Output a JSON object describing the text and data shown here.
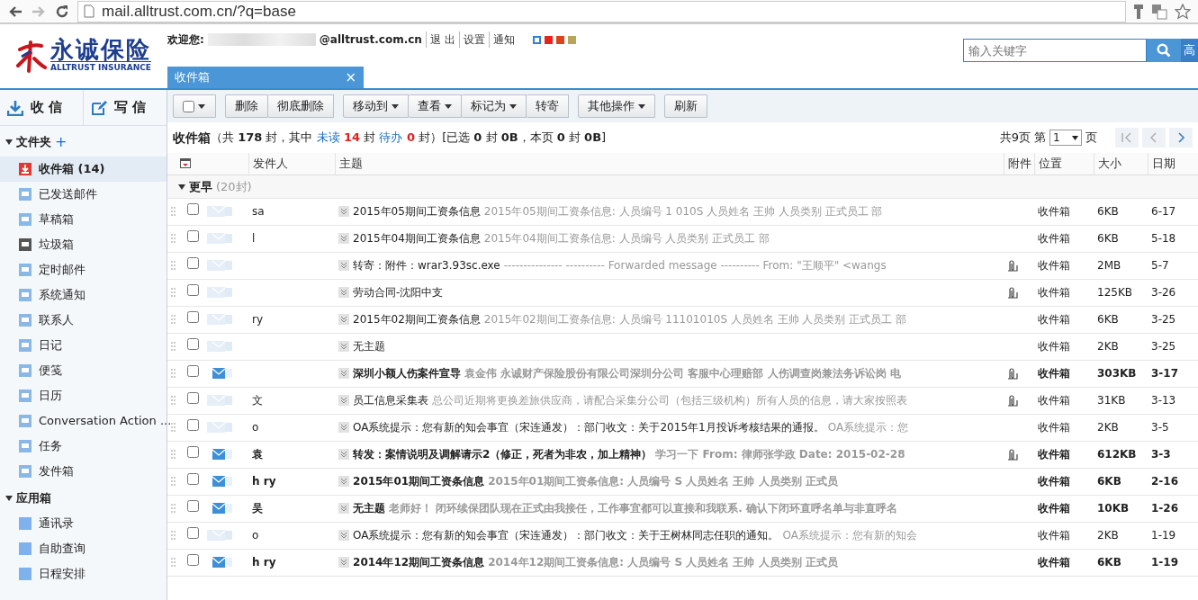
{
  "browser": {
    "url": "mail.alltrust.com.cn/?q=base"
  },
  "logo": {
    "name": "永诚保险",
    "subtitle": "ALLTRUST INSURANCE"
  },
  "user": {
    "greeting": "欢迎您:",
    "email": "@alltrust.com.cn",
    "links": [
      "退 出",
      "设置",
      "通知"
    ],
    "skins": [
      {
        "color": "#2f80d8",
        "selected": true
      },
      {
        "color": "#e8231c",
        "selected": false
      },
      {
        "color": "#d9441a",
        "selected": false
      },
      {
        "color": "#b8a55a",
        "selected": false
      }
    ]
  },
  "search": {
    "placeholder": "输入关键字",
    "advanced": "高"
  },
  "tabs": [
    {
      "label": "收件箱",
      "selected": true,
      "close": "×"
    }
  ],
  "sidebar": {
    "actions": [
      {
        "label": "收 信",
        "kind": "receive"
      },
      {
        "label": "写 信",
        "kind": "compose"
      }
    ],
    "sections": [
      {
        "title": "文件夹",
        "add": "+",
        "expanded": true,
        "items": [
          {
            "label": "收件箱",
            "count": "(14)",
            "kind": "inbox",
            "selected": true
          },
          {
            "label": "已发送邮件",
            "kind": "folder",
            "selected": false
          },
          {
            "label": "草稿箱",
            "kind": "folder",
            "selected": false
          },
          {
            "label": "垃圾箱",
            "kind": "trash",
            "selected": false
          },
          {
            "label": "定时邮件",
            "kind": "folder",
            "selected": false
          },
          {
            "label": "系统通知",
            "kind": "folder",
            "selected": false
          },
          {
            "label": "联系人",
            "kind": "folder",
            "selected": false
          },
          {
            "label": "日记",
            "kind": "folder",
            "selected": false
          },
          {
            "label": "便笺",
            "kind": "folder",
            "selected": false
          },
          {
            "label": "日历",
            "kind": "folder",
            "selected": false
          },
          {
            "label": "Conversation Action ...",
            "kind": "folder",
            "selected": false
          },
          {
            "label": "任务",
            "kind": "folder",
            "selected": false
          },
          {
            "label": "发件箱",
            "kind": "folder",
            "selected": false
          }
        ]
      },
      {
        "title": "应用箱",
        "expanded": true,
        "items": [
          {
            "label": "通讯录",
            "kind": "app",
            "selected": false
          },
          {
            "label": "自助查询",
            "kind": "app",
            "selected": false
          },
          {
            "label": "日程安排",
            "kind": "app",
            "selected": false
          }
        ]
      }
    ]
  },
  "toolbar": [
    [
      {
        "kind": "select",
        "checked": false
      }
    ],
    [
      {
        "label": "删除",
        "kind": "button"
      },
      {
        "label": "彻底删除",
        "kind": "button"
      }
    ],
    [
      {
        "label": "移动到",
        "kind": "menu"
      },
      {
        "label": "查看",
        "kind": "menu"
      },
      {
        "label": "标记为",
        "kind": "menu"
      },
      {
        "label": "转寄",
        "kind": "button"
      }
    ],
    [
      {
        "label": "其他操作",
        "kind": "menu"
      }
    ],
    [
      {
        "label": "刷新",
        "kind": "button"
      }
    ]
  ],
  "summary": {
    "folder": "收件箱",
    "parts": [
      {
        "text": "（共 ",
        "kind": "plain"
      },
      {
        "text": "178",
        "kind": "strong"
      },
      {
        "text": " 封，其中 ",
        "kind": "plain"
      },
      {
        "text": "未读",
        "kind": "link"
      },
      {
        "text": " 14",
        "kind": "alert"
      },
      {
        "text": " 封 ",
        "kind": "plain"
      },
      {
        "text": "待办",
        "kind": "link"
      },
      {
        "text": " 0",
        "kind": "alert"
      },
      {
        "text": " 封）[已选 ",
        "kind": "plain"
      },
      {
        "text": "0",
        "kind": "strong"
      },
      {
        "text": " 封 ",
        "kind": "plain"
      },
      {
        "text": "0B",
        "kind": "strong"
      },
      {
        "text": "，本页 ",
        "kind": "plain"
      },
      {
        "text": "0",
        "kind": "strong"
      },
      {
        "text": " 封 ",
        "kind": "plain"
      },
      {
        "text": "0B",
        "kind": "strong"
      },
      {
        "text": "]",
        "kind": "plain"
      }
    ]
  },
  "pager": {
    "total": "共9页",
    "prefix": "第",
    "page": "1",
    "suffix": "页",
    "buttons": [
      {
        "kind": "first",
        "disabled": true
      },
      {
        "kind": "prev",
        "disabled": true
      },
      {
        "kind": "next",
        "disabled": false
      }
    ]
  },
  "table": {
    "columns": [
      "发件人",
      "主题",
      "附件",
      "位置",
      "大小",
      "日期"
    ],
    "group": {
      "label": "更早",
      "count": "(20封)",
      "expanded": true
    },
    "rows": [
      {
        "checked": false,
        "unread": false,
        "sender": "sa",
        "subject": "2015年05期间工资条信息",
        "preview": "2015年05期间工资条信息: 人员编号 1 010S 人员姓名 王帅 人员类别 正式员工 部",
        "attachment": false,
        "location": "收件箱",
        "size": "6KB",
        "date": "6-17"
      },
      {
        "checked": false,
        "unread": false,
        "sender": "l",
        "subject": "2015年04期间工资条信息",
        "preview": "2015年04期间工资条信息: 人员编号 人员类别 正式员工 部",
        "attachment": false,
        "location": "收件箱",
        "size": "6KB",
        "date": "5-18"
      },
      {
        "checked": false,
        "unread": false,
        "subject": "转寄：附件：wrar3.93sc.exe",
        "preview": "--------------- ---------- Forwarded message ---------- From: \"王顺平\" <wangs",
        "attachment": true,
        "location": "收件箱",
        "size": "2MB",
        "date": "5-7"
      },
      {
        "checked": false,
        "unread": false,
        "subject": "劳动合同-沈阳中支",
        "attachment": true,
        "location": "收件箱",
        "size": "125KB",
        "date": "3-26"
      },
      {
        "checked": false,
        "unread": false,
        "sender": "ry",
        "subject": "2015年02期间工资条信息",
        "preview": "2015年02期间工资条信息: 人员编号 11101010S 人员姓名 王帅 人员类别 正式员工 部",
        "attachment": false,
        "location": "收件箱",
        "size": "6KB",
        "date": "3-25"
      },
      {
        "checked": false,
        "unread": false,
        "subject": "无主题",
        "attachment": false,
        "location": "收件箱",
        "size": "2KB",
        "date": "3-25"
      },
      {
        "checked": false,
        "unread": true,
        "subject": "深圳小额人伤案件宣导",
        "preview": "袁金伟 永诚财产保险股份有限公司深圳分公司 客服中心理赔部 人伤调查岗兼法务诉讼岗 电",
        "attachment": true,
        "location": "收件箱",
        "size": "303KB",
        "date": "3-17"
      },
      {
        "checked": false,
        "unread": false,
        "sender": "文",
        "subject": "员工信息采集表",
        "preview": "总公司近期将更换差旅供应商，请配合采集分公司（包括三级机构）所有人员的信息，请大家按照表",
        "attachment": true,
        "location": "收件箱",
        "size": "31KB",
        "date": "3-13"
      },
      {
        "checked": false,
        "unread": false,
        "sender": "o",
        "subject": "OA系统提示：您有新的知会事宜（宋连通发）：部门收文：关于2015年1月投诉考核结果的通报。",
        "preview": "OA系统提示：您",
        "attachment": false,
        "location": "收件箱",
        "size": "2KB",
        "date": "3-5"
      },
      {
        "checked": false,
        "unread": true,
        "sender": "袁",
        "subject": "转发：案情说明及调解请示2（修正，死者为非农，加上精神）",
        "preview": "学习一下 From: 律师张学政 Date: 2015-02-28",
        "attachment": true,
        "location": "收件箱",
        "size": "612KB",
        "date": "3-3"
      },
      {
        "checked": false,
        "unread": true,
        "sender": "h ry",
        "subject": "2015年01期间工资条信息",
        "preview": "2015年01期间工资条信息: 人员编号 S 人员姓名 王帅 人员类别 正式员",
        "attachment": false,
        "location": "收件箱",
        "size": "6KB",
        "date": "2-16"
      },
      {
        "checked": false,
        "unread": true,
        "sender": "吴",
        "subject": "无主题",
        "preview": "老师好！ 闭环续保团队现在正式由我接任，工作事宜都可以直接和我联系. 确认下闭环直呼名单与非直呼名",
        "attachment": false,
        "location": "收件箱",
        "size": "10KB",
        "date": "1-26"
      },
      {
        "checked": false,
        "unread": false,
        "sender": "o",
        "subject": "OA系统提示：您有新的知会事宜（宋连通发）：部门收文：关于王树林同志任职的通知。",
        "preview": "OA系统提示：您有新的知会",
        "attachment": false,
        "location": "收件箱",
        "size": "2KB",
        "date": "1-19"
      },
      {
        "checked": false,
        "unread": true,
        "sender": "h ry",
        "subject": "2014年12期间工资条信息",
        "preview": "2014年12期间工资条信息: 人员编号 S 人员姓名 王帅 人员类别 正式员",
        "attachment": false,
        "location": "收件箱",
        "size": "6KB",
        "date": "1-19"
      }
    ]
  }
}
